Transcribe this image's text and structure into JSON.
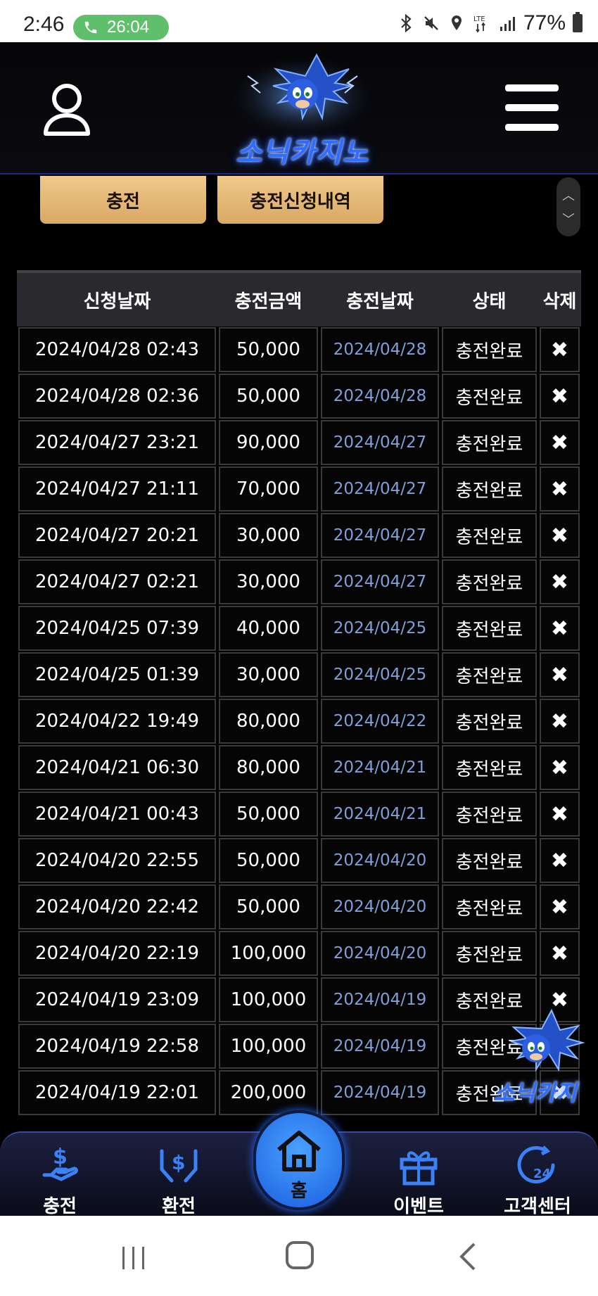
{
  "status_bar": {
    "time": "2:46",
    "call_timer": "26:04",
    "battery": "77%"
  },
  "header": {
    "logo_text": "소닉카지노"
  },
  "tabs": {
    "charge": "충전",
    "history": "충전신청내역"
  },
  "table": {
    "headers": [
      "신청날짜",
      "충전금액",
      "충전날짜",
      "상태",
      "삭제"
    ],
    "delete_symbol": "✖",
    "rows": [
      [
        "2024/04/28 02:43",
        "50,000",
        "2024/04/28",
        "충전완료"
      ],
      [
        "2024/04/28 02:36",
        "50,000",
        "2024/04/28",
        "충전완료"
      ],
      [
        "2024/04/27 23:21",
        "90,000",
        "2024/04/27",
        "충전완료"
      ],
      [
        "2024/04/27 21:11",
        "70,000",
        "2024/04/27",
        "충전완료"
      ],
      [
        "2024/04/27 20:21",
        "30,000",
        "2024/04/27",
        "충전완료"
      ],
      [
        "2024/04/27 02:21",
        "30,000",
        "2024/04/27",
        "충전완료"
      ],
      [
        "2024/04/25 07:39",
        "40,000",
        "2024/04/25",
        "충전완료"
      ],
      [
        "2024/04/25 01:39",
        "30,000",
        "2024/04/25",
        "충전완료"
      ],
      [
        "2024/04/22 19:49",
        "80,000",
        "2024/04/22",
        "충전완료"
      ],
      [
        "2024/04/21 06:30",
        "80,000",
        "2024/04/21",
        "충전완료"
      ],
      [
        "2024/04/21 00:43",
        "50,000",
        "2024/04/21",
        "충전완료"
      ],
      [
        "2024/04/20 22:55",
        "50,000",
        "2024/04/20",
        "충전완료"
      ],
      [
        "2024/04/20 22:42",
        "50,000",
        "2024/04/20",
        "충전완료"
      ],
      [
        "2024/04/20 22:19",
        "100,000",
        "2024/04/20",
        "충전완료"
      ],
      [
        "2024/04/19 23:09",
        "100,000",
        "2024/04/19",
        "충전완료"
      ],
      [
        "2024/04/19 22:58",
        "100,000",
        "2024/04/19",
        "충전완료"
      ],
      [
        "2024/04/19 22:01",
        "200,000",
        "2024/04/19",
        "충전완료"
      ]
    ]
  },
  "floating_badge_text": "소닉카지",
  "bottom_nav": {
    "charge": "충전",
    "exchange": "환전",
    "home": "홈",
    "event": "이벤트",
    "support": "고객센터"
  },
  "colors": {
    "accent_blue": "#2f6dff",
    "tab_gold": "#e3b877",
    "date_link": "#7fa0d8"
  }
}
